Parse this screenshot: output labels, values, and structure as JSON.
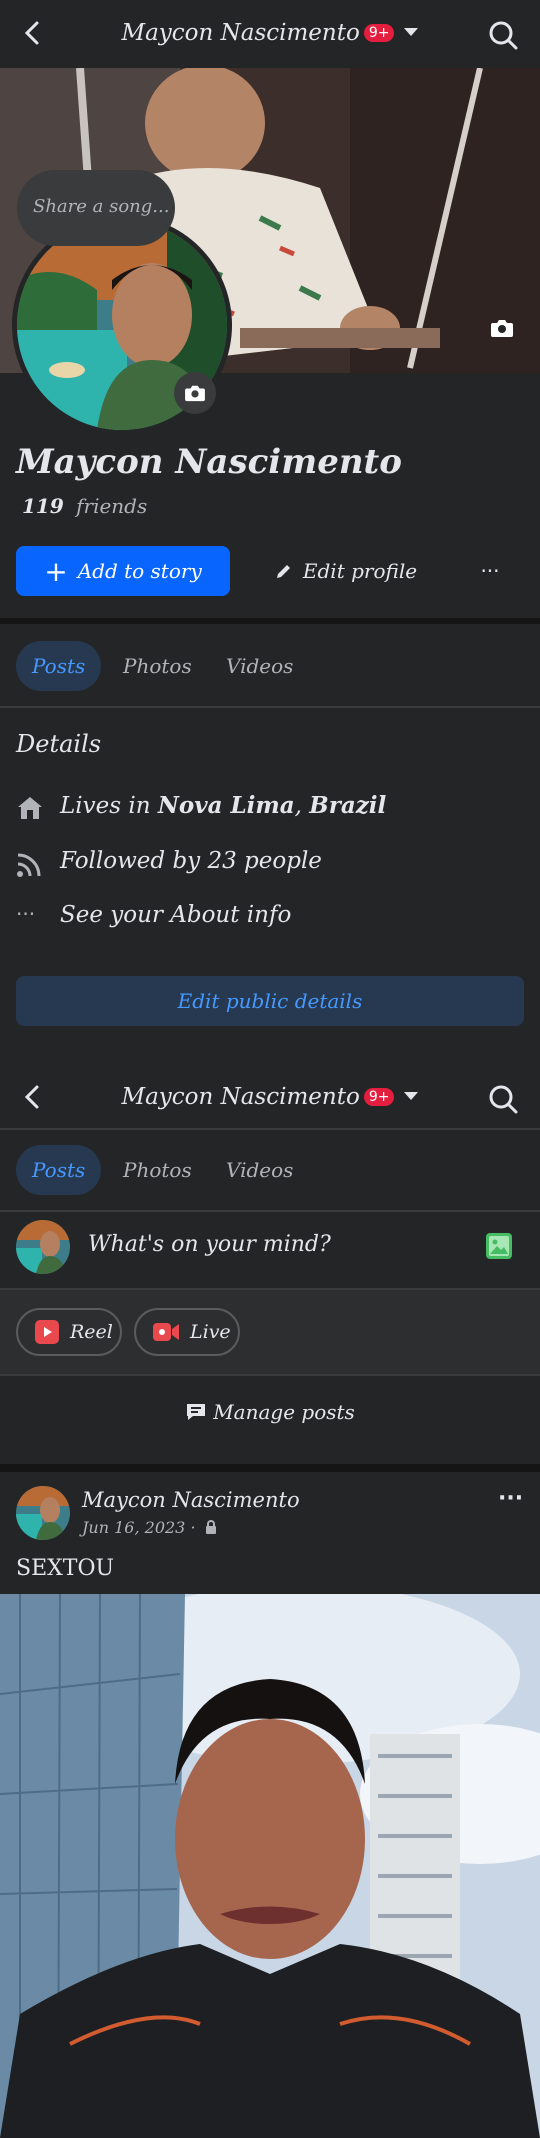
{
  "header": {
    "title": "Maycon Nascimento",
    "badge": "9+"
  },
  "profile": {
    "name": "Maycon Nascimento",
    "friends_count": "119",
    "friends_label": "friends",
    "song_prompt": "Share a song..."
  },
  "actions": {
    "add_story": "Add to story",
    "edit_profile": "Edit profile",
    "more": "···"
  },
  "tabs": [
    "Posts",
    "Photos",
    "Videos"
  ],
  "details": {
    "heading": "Details",
    "lives_prefix": "Lives in",
    "lives_city": "Nova Lima",
    "lives_sep": ",",
    "lives_country": "Brazil",
    "followed": "Followed by 23 people",
    "about": "See your About info",
    "edit_public": "Edit public details"
  },
  "composer": {
    "placeholder": "What's on your mind?"
  },
  "chips": {
    "reel": "Reel",
    "live": "Live"
  },
  "manage_posts": "Manage posts",
  "post": {
    "author": "Maycon Nascimento",
    "date": "Jun 16, 2023 ·",
    "text": "SEXTOU"
  },
  "colors": {
    "background": "#242526",
    "accent": "#0866ff",
    "tab_active_bg": "#263951",
    "tab_active_text": "#4599ff",
    "edit_public_bg": "#263951",
    "badge": "#e41e3f"
  }
}
